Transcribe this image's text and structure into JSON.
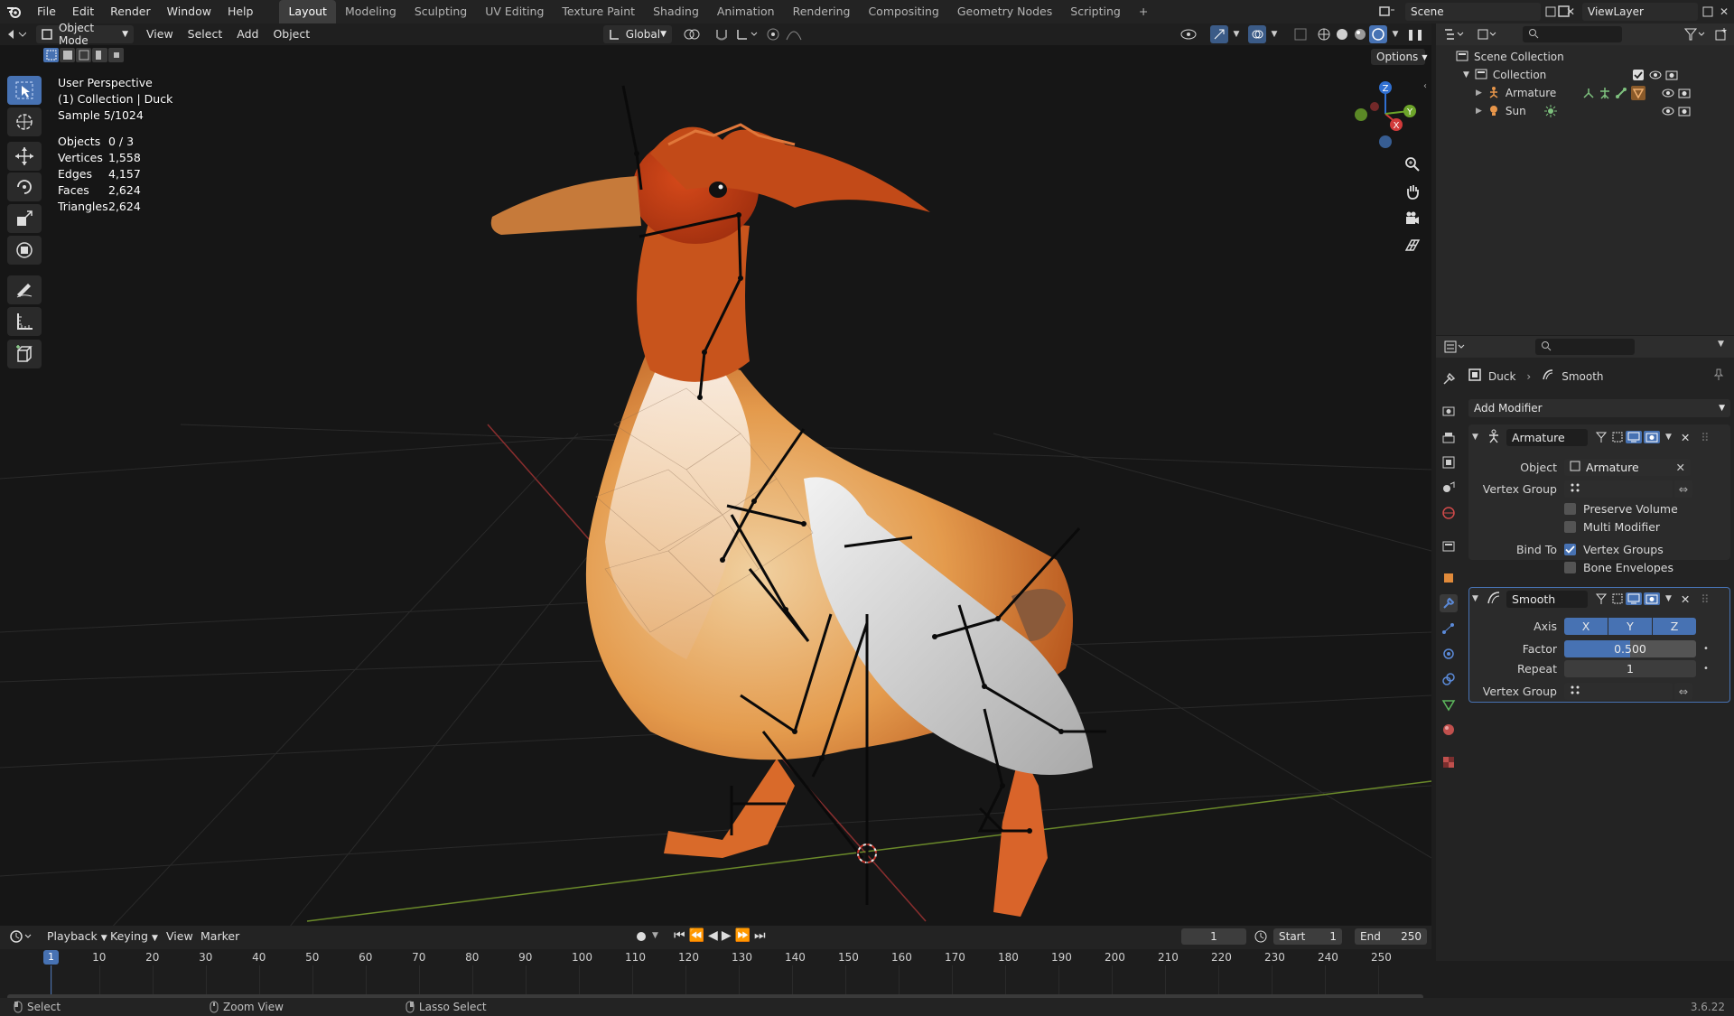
{
  "menus": [
    "File",
    "Edit",
    "Render",
    "Window",
    "Help"
  ],
  "workspaces": [
    "Layout",
    "Modeling",
    "Sculpting",
    "UV Editing",
    "Texture Paint",
    "Shading",
    "Animation",
    "Rendering",
    "Compositing",
    "Geometry Nodes",
    "Scripting"
  ],
  "top_right": {
    "scene_label": "Scene",
    "viewlayer_label": "ViewLayer"
  },
  "vp_header": {
    "mode": "Object Mode",
    "view": "View",
    "select": "Select",
    "add": "Add",
    "object": "Object",
    "orientation": "Global",
    "options": "Options"
  },
  "overlay": {
    "perspective": "User Perspective",
    "collection": "(1) Collection | Duck",
    "sample": "Sample 5/1024",
    "stats": [
      {
        "k": "Objects",
        "v": "0 / 3"
      },
      {
        "k": "Vertices",
        "v": "1,558"
      },
      {
        "k": "Edges",
        "v": "4,157"
      },
      {
        "k": "Faces",
        "v": "2,624"
      },
      {
        "k": "Triangles",
        "v": "2,624"
      }
    ]
  },
  "gizmo": {
    "z": "Z",
    "x": "X",
    "y": "Y"
  },
  "outliner": {
    "scene_collection": "Scene Collection",
    "collection": "Collection",
    "items": [
      {
        "label": "Armature"
      },
      {
        "label": "Sun"
      }
    ]
  },
  "properties": {
    "breadcrumb_object": "Duck",
    "breadcrumb_modifier": "Smooth",
    "add_modifier": "Add Modifier",
    "armature_mod": {
      "name": "Armature",
      "object_label": "Object",
      "object_value": "Armature",
      "vgroup_label": "Vertex Group",
      "preserve_volume": "Preserve Volume",
      "multi_modifier": "Multi Modifier",
      "bind_to_label": "Bind To",
      "vertex_groups": "Vertex Groups",
      "bone_envelopes": "Bone Envelopes"
    },
    "smooth_mod": {
      "name": "Smooth",
      "axis_label": "Axis",
      "axis_x": "X",
      "axis_y": "Y",
      "axis_z": "Z",
      "factor_label": "Factor",
      "factor_value": "0.500",
      "repeat_label": "Repeat",
      "repeat_value": "1",
      "vgroup_label": "Vertex Group"
    }
  },
  "timeline": {
    "playback": "Playback",
    "keying": "Keying",
    "view": "View",
    "marker": "Marker",
    "current_frame": "1",
    "start_label": "Start",
    "start_value": "1",
    "end_label": "End",
    "end_value": "250",
    "ruler": [
      "1",
      "10",
      "20",
      "30",
      "40",
      "50",
      "60",
      "70",
      "80",
      "90",
      "100",
      "110",
      "120",
      "130",
      "140",
      "150",
      "160",
      "170",
      "180",
      "190",
      "200",
      "210",
      "220",
      "230",
      "240",
      "250"
    ],
    "current_badge": "1"
  },
  "status": {
    "select": "Select",
    "zoom": "Zoom View",
    "lasso": "Lasso Select",
    "version": "3.6.22"
  },
  "colors": {
    "accent": "#4772b3",
    "bg": "#1d1d1d",
    "panel": "#232323"
  }
}
